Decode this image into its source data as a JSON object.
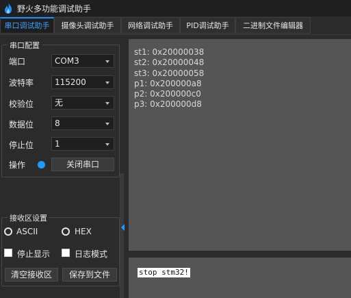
{
  "window": {
    "title": "野火多功能调试助手",
    "icon": "flame-icon"
  },
  "tabs": [
    {
      "label": "串口调试助手",
      "active": true
    },
    {
      "label": "摄像头调试助手",
      "active": false
    },
    {
      "label": "网络调试助手",
      "active": false
    },
    {
      "label": "PID调试助手",
      "active": false
    },
    {
      "label": "二进制文件编辑器",
      "active": false
    }
  ],
  "serial_config": {
    "title": "串口配置",
    "port": {
      "label": "端口",
      "value": "COM3"
    },
    "baud": {
      "label": "波特率",
      "value": "115200"
    },
    "parity": {
      "label": "校验位",
      "value": "无"
    },
    "databits": {
      "label": "数据位",
      "value": "8"
    },
    "stopbits": {
      "label": "停止位",
      "value": "1"
    },
    "operation": {
      "label": "操作",
      "button": "关闭串口",
      "status_color": "#1e9bff"
    }
  },
  "receive_settings": {
    "title": "接收区设置",
    "ascii_label": "ASCII",
    "hex_label": "HEX",
    "stop_display_label": "停止显示",
    "log_mode_label": "日志模式",
    "clear_button": "清空接收区",
    "save_button": "保存到文件"
  },
  "receive_area": {
    "lines": [
      "st1: 0x20000038",
      "st2: 0x20000048",
      "st3: 0x20000058",
      "p1: 0x200000a8",
      "p2: 0x200000c0",
      "p3: 0x200000d8"
    ]
  },
  "send_area": {
    "text": "stop stm32!"
  },
  "colors": {
    "accent": "#1e9bff",
    "panel_bg": "#2b2b2b",
    "text_area_bg": "#555555"
  }
}
